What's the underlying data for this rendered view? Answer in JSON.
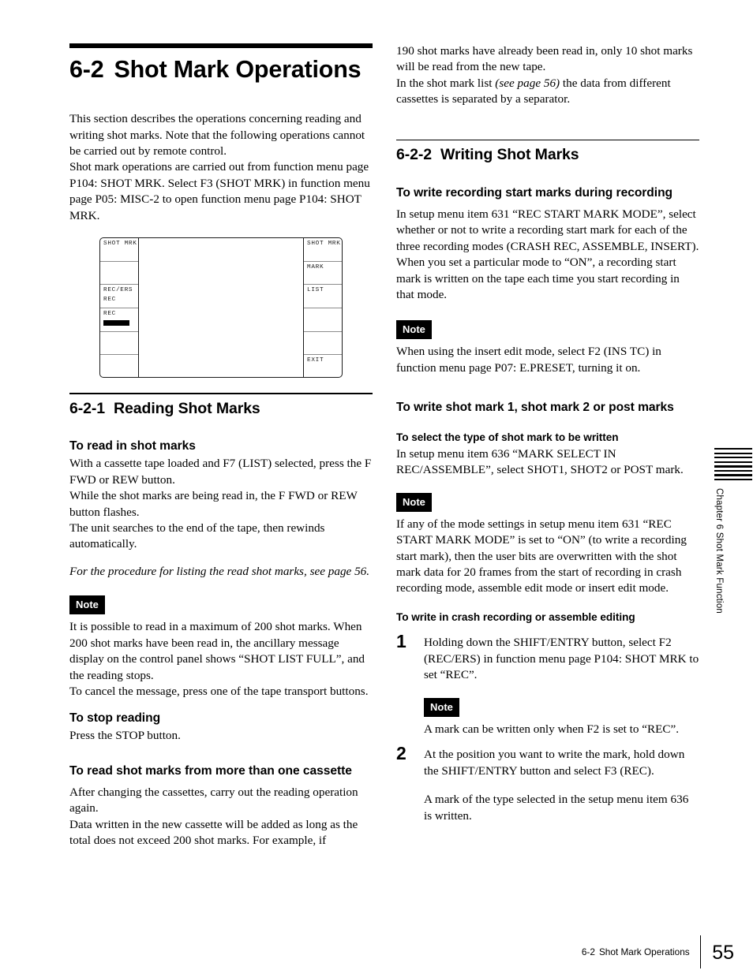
{
  "document": {
    "chapter_title_number": "6-2",
    "chapter_title_text": "Shot Mark Operations",
    "intro_paragraph_1": "This section describes the operations concerning reading and writing shot marks. Note that the following operations cannot be carried out by remote control.",
    "intro_paragraph_2": "Shot mark operations are carried out from function menu page P104: SHOT MRK. Select F3 (SHOT MRK) in function menu page P05: MISC-2 to open function menu page P104: SHOT MRK."
  },
  "figure": {
    "name": "function-menu-p104-shot-mrk",
    "left_column": [
      {
        "line1": "SHOT MRK",
        "line2": "",
        "selected": false
      },
      {
        "line1": "",
        "line2": "",
        "selected": false
      },
      {
        "line1": "REC/ERS",
        "line2": "REC",
        "selected": false
      },
      {
        "line1": "REC",
        "line2": "",
        "selected": true
      },
      {
        "line1": "",
        "line2": "",
        "selected": false
      },
      {
        "line1": "",
        "line2": "",
        "selected": false
      }
    ],
    "right_column": [
      {
        "line1": "SHOT MRK",
        "line2": "",
        "selected": false
      },
      {
        "line1": "MARK",
        "line2": "",
        "selected": false
      },
      {
        "line1": "LIST",
        "line2": "",
        "selected": false
      },
      {
        "line1": "",
        "line2": "",
        "selected": false
      },
      {
        "line1": "",
        "line2": "",
        "selected": false
      },
      {
        "line1": "EXIT",
        "line2": "",
        "selected": false
      }
    ]
  },
  "section_621": {
    "number": "6-2-1",
    "title": "Reading Shot Marks",
    "head_read_in": "To read in shot marks",
    "para_read_in_1": "With a cassette tape loaded and F7 (LIST) selected, press the F FWD or REW button.",
    "para_read_in_2": "While the shot marks are being read in, the F FWD or REW button flashes.",
    "para_read_in_3": "The unit searches to the end of the tape, then rewinds automatically.",
    "cross_reference": "For the procedure for listing the read shot marks, see page 56.",
    "note_label": "Note",
    "note_text_1": "It is possible to read in a maximum of 200 shot marks. When 200 shot marks have been read in, the ancillary message display on the control panel shows “SHOT LIST FULL”, and the reading stops.",
    "note_text_2": "To cancel the message, press one of the tape transport buttons.",
    "head_stop_reading": "To stop reading",
    "para_stop_reading": "Press the STOP button.",
    "head_more_than_one": "To read shot marks from more than one cassette",
    "para_more_1": "After changing the cassettes, carry out the reading operation again.",
    "para_more_2": "Data written in the new cassette will be added as long as the total does not exceed 200 shot marks. For example, if"
  },
  "right_column_top": {
    "continuation_1": "190 shot marks have already been read in, only 10 shot marks will be read from the new tape.",
    "continuation_2_a": "In the shot mark list ",
    "continuation_2_italic": "(see page 56)",
    "continuation_2_b": " the data from different cassettes is separated by a separator."
  },
  "section_622": {
    "number": "6-2-2",
    "title": "Writing Shot Marks",
    "head_rec_start": "To write recording start marks during recording",
    "para_rec_start_1": "In setup menu item 631 “REC START MARK MODE”, select whether or not to write a recording start mark for each of the three recording modes (CRASH REC, ASSEMBLE, INSERT).",
    "para_rec_start_2": "When you set a particular mode to “ON”, a recording start mark is written on the tape each time you start recording in that mode.",
    "note1_label": "Note",
    "note1_text": "When using the insert edit mode, select F2 (INS TC) in function menu page P07: E.PRESET, turning it on.",
    "head_write_marks": "To write shot mark 1, shot mark 2 or post marks",
    "head_select_type": "To select the type of shot mark to be written",
    "para_select_type": "In setup menu item 636 “MARK SELECT IN REC/ASSEMBLE”, select SHOT1, SHOT2 or POST mark.",
    "note2_label": "Note",
    "note2_text": "If any of the mode settings in setup menu item 631 “REC START MARK MODE” is set to “ON” (to write a recording start mark), then the user bits are overwritten with the shot mark data for 20 frames from the start of recording in crash recording mode, assemble edit mode or insert edit mode.",
    "head_crash_rec": "To write in crash recording or assemble editing",
    "step1_num": "1",
    "step1_text": "Holding down the SHIFT/ENTRY button, select F2 (REC/ERS) in function menu page P104: SHOT MRK to set “REC”.",
    "step1_note_label": "Note",
    "step1_note_text": "A mark can be written only when F2 is set to “REC”.",
    "step2_num": "2",
    "step2_text": "At the position you want to write the mark, hold down the SHIFT/ENTRY button and select F3 (REC).",
    "step2_para": "A mark of the type selected in the setup menu item 636 is written."
  },
  "side_tab": {
    "label": "Chapter 6  Shot Mark Function",
    "line_count": 8
  },
  "footer": {
    "section_number": "6-2",
    "section_name": "Shot Mark Operations",
    "page_number": "55"
  }
}
